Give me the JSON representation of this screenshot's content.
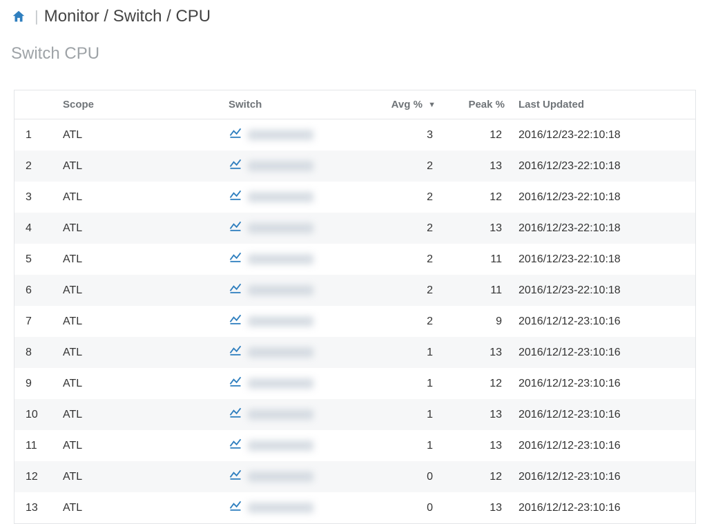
{
  "breadcrumb": "Monitor / Switch / CPU",
  "page_title": "Switch CPU",
  "columns": {
    "row": "",
    "scope": "Scope",
    "switch": "Switch",
    "avg": "Avg %",
    "peak": "Peak %",
    "updated": "Last Updated"
  },
  "sort_indicator": "▼",
  "rows": [
    {
      "n": "1",
      "scope": "ATL",
      "avg": "3",
      "peak": "12",
      "updated": "2016/12/23-22:10:18"
    },
    {
      "n": "2",
      "scope": "ATL",
      "avg": "2",
      "peak": "13",
      "updated": "2016/12/23-22:10:18"
    },
    {
      "n": "3",
      "scope": "ATL",
      "avg": "2",
      "peak": "12",
      "updated": "2016/12/23-22:10:18"
    },
    {
      "n": "4",
      "scope": "ATL",
      "avg": "2",
      "peak": "13",
      "updated": "2016/12/23-22:10:18"
    },
    {
      "n": "5",
      "scope": "ATL",
      "avg": "2",
      "peak": "11",
      "updated": "2016/12/23-22:10:18"
    },
    {
      "n": "6",
      "scope": "ATL",
      "avg": "2",
      "peak": "11",
      "updated": "2016/12/23-22:10:18"
    },
    {
      "n": "7",
      "scope": "ATL",
      "avg": "2",
      "peak": "9",
      "updated": "2016/12/12-23:10:16"
    },
    {
      "n": "8",
      "scope": "ATL",
      "avg": "1",
      "peak": "13",
      "updated": "2016/12/12-23:10:16"
    },
    {
      "n": "9",
      "scope": "ATL",
      "avg": "1",
      "peak": "12",
      "updated": "2016/12/12-23:10:16"
    },
    {
      "n": "10",
      "scope": "ATL",
      "avg": "1",
      "peak": "13",
      "updated": "2016/12/12-23:10:16"
    },
    {
      "n": "11",
      "scope": "ATL",
      "avg": "1",
      "peak": "13",
      "updated": "2016/12/12-23:10:16"
    },
    {
      "n": "12",
      "scope": "ATL",
      "avg": "0",
      "peak": "12",
      "updated": "2016/12/12-23:10:16"
    },
    {
      "n": "13",
      "scope": "ATL",
      "avg": "0",
      "peak": "13",
      "updated": "2016/12/12-23:10:16"
    }
  ]
}
